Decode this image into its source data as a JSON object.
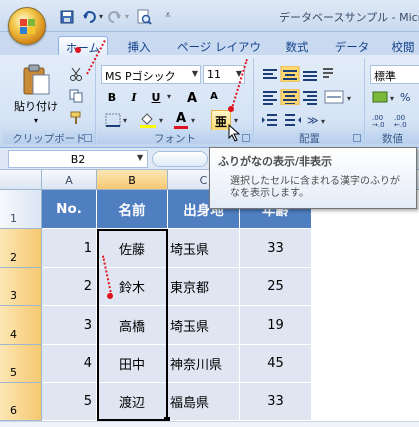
{
  "title_bar": {
    "title": "データベースサンプル - Micro"
  },
  "tabs": [
    {
      "label": "ホーム",
      "active": true
    },
    {
      "label": "挿入"
    },
    {
      "label": "ページ レイアウト"
    },
    {
      "label": "数式"
    },
    {
      "label": "データ"
    },
    {
      "label": "校閲"
    }
  ],
  "ribbon": {
    "clipboard": {
      "paste_label": "貼り付け",
      "group_label": "クリップボード"
    },
    "font": {
      "font_name": "MS Pゴシック",
      "font_size": "11",
      "bold": "B",
      "italic": "I",
      "underline": "U",
      "grow": "A",
      "shrink": "A",
      "font_color_letter": "A",
      "highlight_color": "#ffff00",
      "font_color": "#e0141e",
      "phonetic_label": "亜",
      "group_label": "フォント"
    },
    "alignment": {
      "group_label": "配置"
    },
    "number": {
      "format": "標準",
      "group_label": "数値"
    }
  },
  "formula_bar": {
    "name_box": "B2"
  },
  "tooltip": {
    "title": "ふりがなの表示/非表示",
    "body_line1": "選択したセルに含まれる漢字のふりが",
    "body_line2": "なを表示します。"
  },
  "grid": {
    "columns": [
      "A",
      "B",
      "C",
      "D"
    ],
    "rows": [
      "1",
      "2",
      "3",
      "4",
      "5",
      "6"
    ],
    "header": [
      "No.",
      "名前",
      "出身地",
      "年齢"
    ],
    "records": [
      [
        "1",
        "佐藤",
        "埼玉県",
        "33"
      ],
      [
        "2",
        "鈴木",
        "東京都",
        "25"
      ],
      [
        "3",
        "高橋",
        "埼玉県",
        "19"
      ],
      [
        "4",
        "田中",
        "神奈川県",
        "45"
      ],
      [
        "5",
        "渡辺",
        "福島県",
        "33"
      ]
    ]
  },
  "colors": {
    "header_fill": "#4f7ec1",
    "body_fill": "#dfe6f2",
    "annotation_red": "#e0141e"
  }
}
